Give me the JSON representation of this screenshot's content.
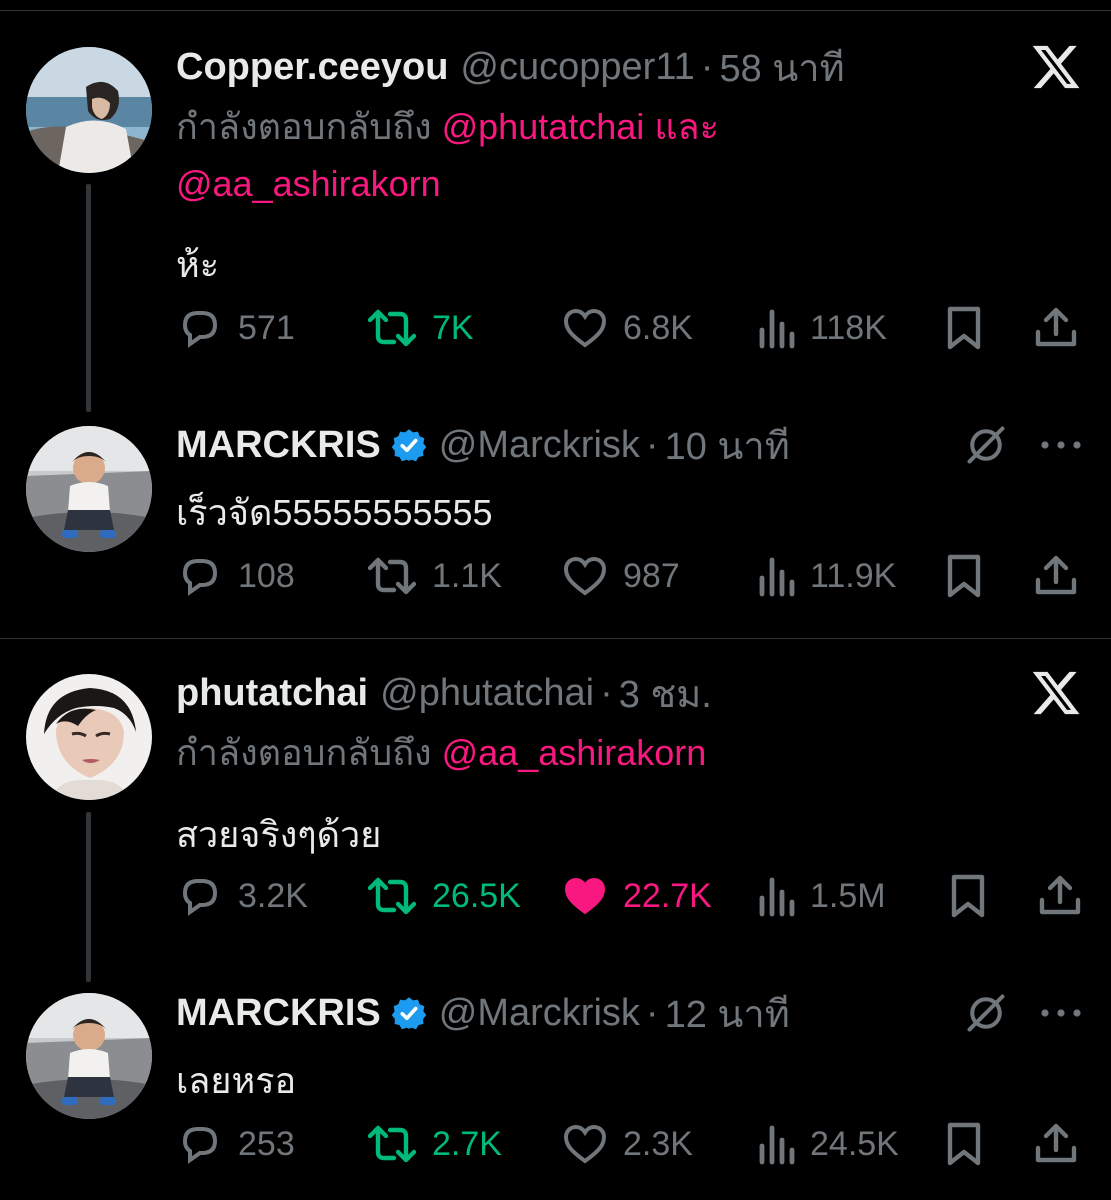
{
  "tweets": [
    {
      "name": "Copper.ceeyou",
      "handle": "@cucopper11",
      "separator": "·",
      "time": "58 นาที",
      "replying_prefix": "กำลังตอบกลับถึง",
      "replying_mentions": [
        "@phutatchai",
        "@aa_ashirakorn"
      ],
      "replying_conjunction": "และ",
      "text": "ห้ะ",
      "stats": {
        "replies": "571",
        "reposts": "7K",
        "likes": "6.8K",
        "views": "118K"
      },
      "reposted": true,
      "liked": false
    },
    {
      "name": "MARCKRIS",
      "handle": "@Marckrisk",
      "separator": "·",
      "time": "10 นาที",
      "verified": true,
      "text": "เร็วจัด55555555555",
      "stats": {
        "replies": "108",
        "reposts": "1.1K",
        "likes": "987",
        "views": "11.9K"
      },
      "reposted": false,
      "liked": false
    },
    {
      "name": "phutatchai",
      "handle": "@phutatchai",
      "separator": "·",
      "time": "3 ชม.",
      "replying_prefix": "กำลังตอบกลับถึง",
      "replying_mentions": [
        "@aa_ashirakorn"
      ],
      "text": "สวยจริงๆด้วย",
      "stats": {
        "replies": "3.2K",
        "reposts": "26.5K",
        "likes": "22.7K",
        "views": "1.5M"
      },
      "reposted": true,
      "liked": true
    },
    {
      "name": "MARCKRIS",
      "handle": "@Marckrisk",
      "separator": "·",
      "time": "12 นาที",
      "verified": true,
      "text": "เลยหรอ",
      "stats": {
        "replies": "253",
        "reposts": "2.7K",
        "likes": "2.3K",
        "views": "24.5K"
      },
      "reposted": true,
      "liked": false
    }
  ],
  "icons": {
    "reply": "speech-bubble-icon",
    "repost": "repost-arrows-icon",
    "like": "heart-icon",
    "views": "bar-chart-icon",
    "bookmark": "bookmark-icon",
    "share": "share-upload-icon",
    "close": "x-logo-icon",
    "grok": "grok-slash-circle-icon",
    "more": "more-dots-icon"
  },
  "colors": {
    "background": "#000000",
    "text": "#e7e9ea",
    "muted": "#71767b",
    "mention": "#f91880",
    "repost_active": "#00ba7c",
    "like_active": "#f91880",
    "verified": "#1d9bf0"
  }
}
